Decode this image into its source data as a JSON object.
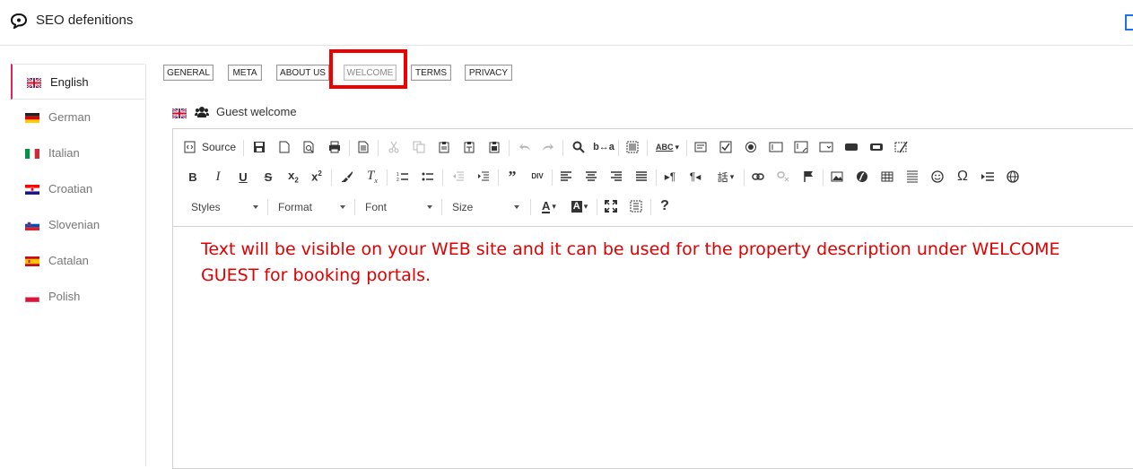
{
  "app": {
    "title": "SEO defenitions"
  },
  "languages": [
    {
      "label": "English",
      "flag": "uk-flag",
      "active": true
    },
    {
      "label": "German",
      "flag": "germany-flag",
      "active": false
    },
    {
      "label": "Italian",
      "flag": "italy-flag",
      "active": false
    },
    {
      "label": "Croatian",
      "flag": "croatia-flag",
      "active": false
    },
    {
      "label": "Slovenian",
      "flag": "slovenia-flag",
      "active": false
    },
    {
      "label": "Catalan",
      "flag": "spain-flag",
      "active": false
    },
    {
      "label": "Polish",
      "flag": "poland-flag",
      "active": false
    }
  ],
  "tabs": [
    {
      "label": "GENERAL"
    },
    {
      "label": "META"
    },
    {
      "label": "ABOUT US"
    },
    {
      "label": "WELCOME",
      "selected": true
    },
    {
      "label": "TERMS"
    },
    {
      "label": "PRIVACY"
    }
  ],
  "section": {
    "label": "Guest welcome"
  },
  "toolbar": {
    "source_label": "Source",
    "styles_label": "Styles",
    "format_label": "Format",
    "font_label": "Font",
    "size_label": "Size"
  },
  "editor": {
    "content": "Text will be visible on your WEB site and it can be used for the property description under WELCOME GUEST for booking portals."
  },
  "colors": {
    "accent": "#e0245e",
    "highlight": "#ee0000",
    "content_text": "#e00000"
  }
}
